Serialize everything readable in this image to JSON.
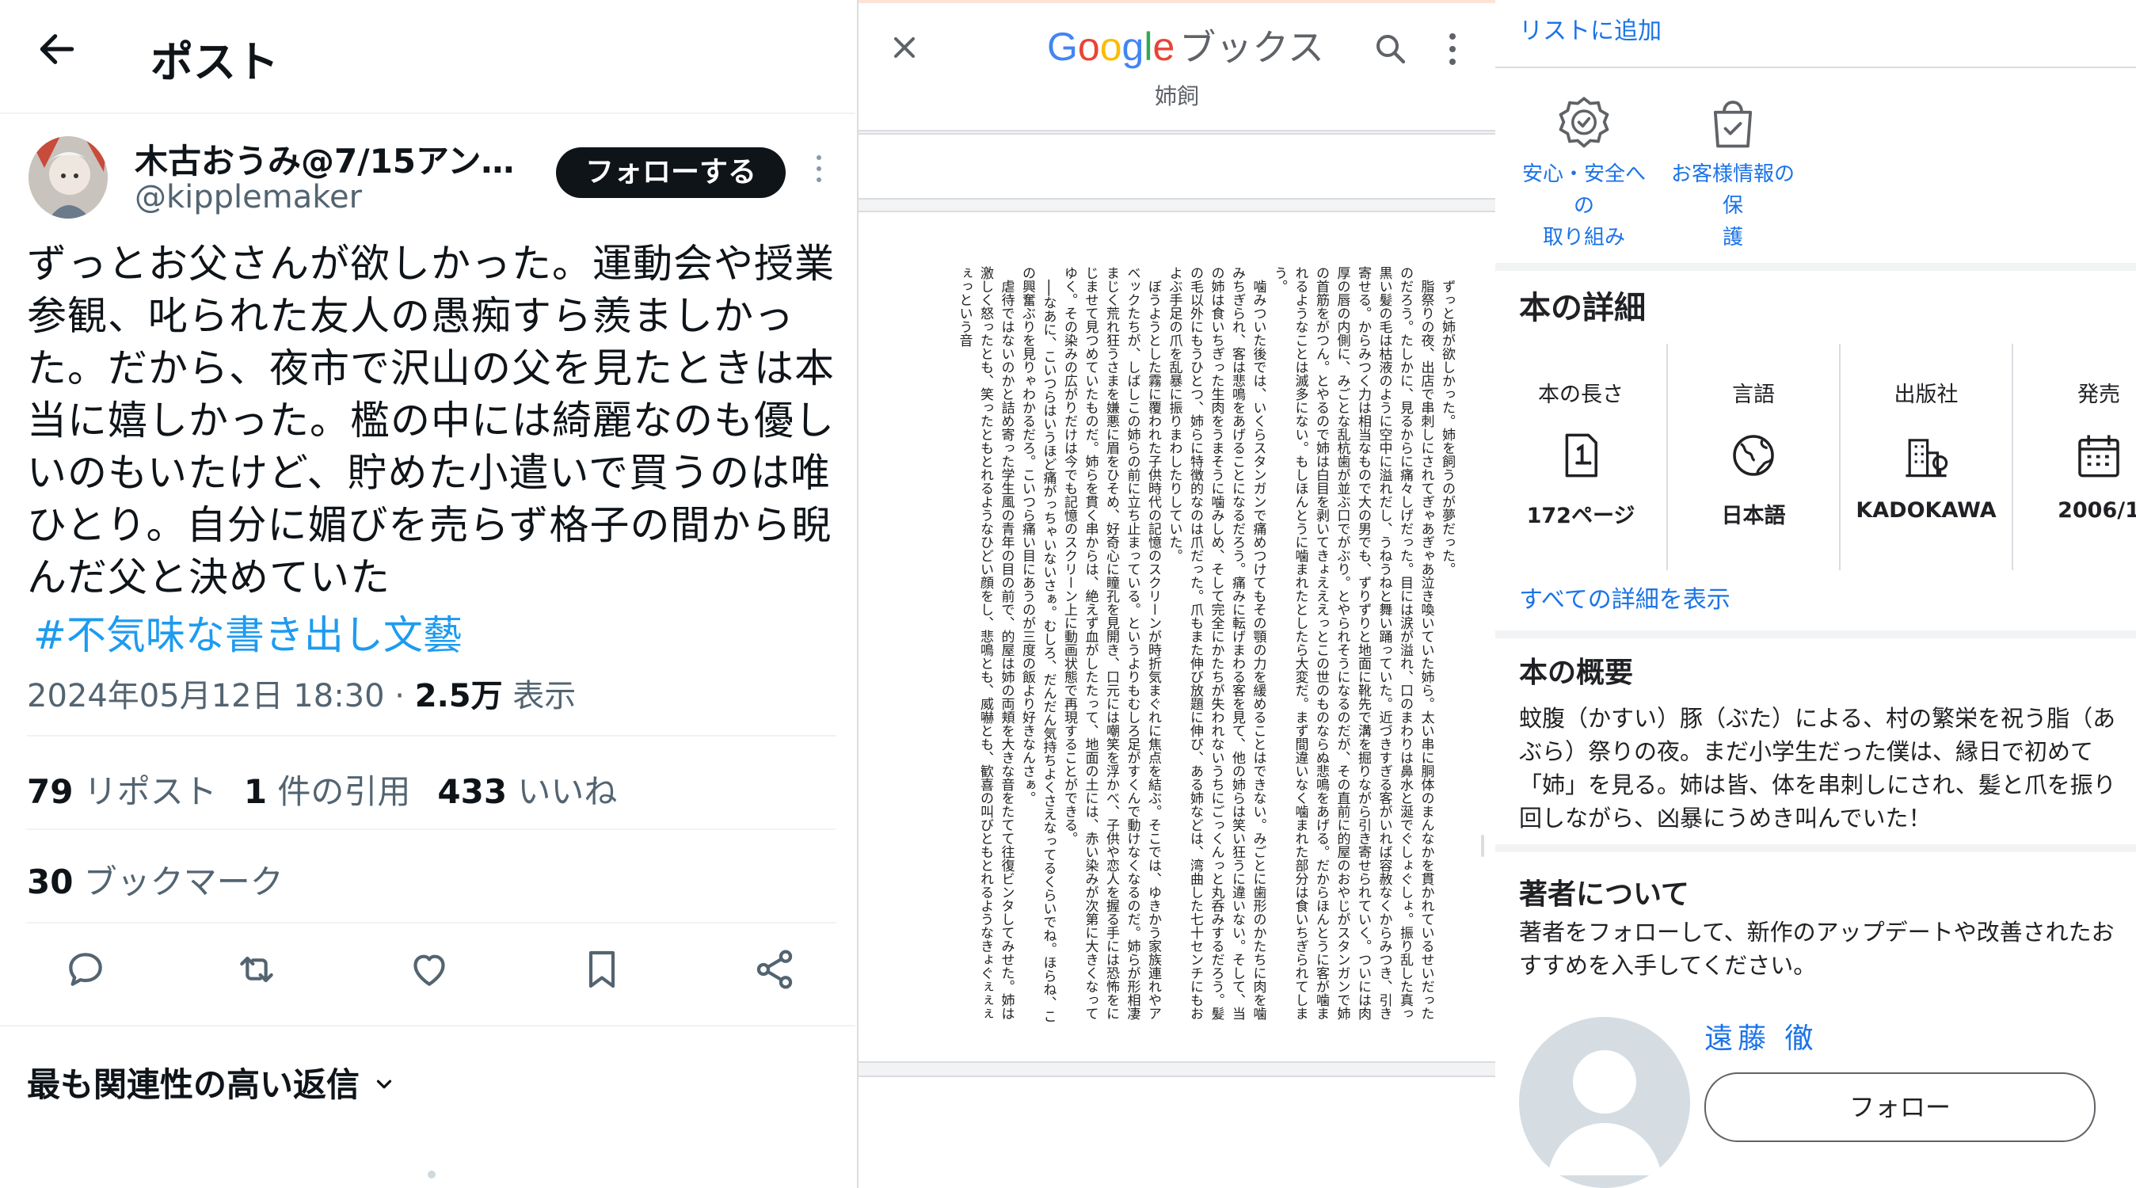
{
  "post_panel": {
    "header_title": "ポスト",
    "author_name": "木古おうみ@7/15アンソ…",
    "author_handle": "@kipplemaker",
    "follow_label": "フォローする",
    "text_lines": [
      "ずっとお父さんが欲しかった。運動会や授業",
      "参観、叱られた友人の愚痴すら羨ましかっ",
      "た。だから、夜市で沢山の父を見たときは本",
      "当に嬉しかった。檻の中には綺麗なのも優し",
      "いのもいたけど、貯めた小遣いで買うのは唯",
      "ひとり。自分に媚びを売らず格子の間から睨",
      "んだ父と決めていた"
    ],
    "hashtag": "#不気味な書き出し文藝",
    "timestamp": "2024年05月12日 18:30 · ",
    "views_count": "2.5万",
    "views_label": " 表示",
    "reposts_count": "79",
    "reposts_label": " リポスト",
    "quotes_count": "1",
    "quotes_label": " 件の引用",
    "likes_count": "433",
    "likes_label": " いいね",
    "bookmarks_count": "30",
    "bookmarks_label": " ブックマーク",
    "reply_sort_label": "最も関連性の高い返信"
  },
  "reader_panel": {
    "logo_product": "ブックス",
    "logo_colors": [
      "#4285f4",
      "#ea4335",
      "#fbbc05",
      "#4285f4",
      "#34a853",
      "#ea4335"
    ],
    "book_title": "姉飼",
    "page_paragraphs": [
      "ずっと姉が欲しかった。姉を飼うのが夢だった。",
      "脂祭りの夜、出店で串刺しにされてぎゃあぎゃあ泣き喚いていた姉ら。太い串に胴体のまんなかを貫かれているせいだったのだろう。たしかに、見るからに痛々しげだった。目には涙が溢れ、口のまわりは鼻水と涎でぐしょぐしょ。振り乱した真っ黒い髪の毛は枯液のように空中に溢れだし、うねうねと舞い踊っていた。近づきすぎる客がいれば容赦なくからみつき、引き寄せる。からみつく力は相当なもので大の男でも、ずりずりと地面に靴先で溝を掘りながら引き寄せられていく。ついには肉厚の唇の内側に、みごとな乱杭歯が並ぶ口でがぶり。とやられそうになるのだが、その直前に的屋のおやじがスタンガンで姉の首筋をがつん。とやるので姉は白目を剥いてきょえええっとこの世のものならぬ悲鳴をあげる。だからほんとうに客が噛まれるようなことは滅多にない。もしほんとうに噛まれたとしたら大変だ。まず間違いなく噛まれた部分は食いちぎられてしまう。",
      "噛みついた後では、いくらスタンガンで痛めつけてもその顎の力を緩めることはできない。みごとに歯形のかたちに肉を噛みちぎられ、客は悲鳴をあげることになるだろう。痛みに転げまわる客を見て、他の姉らは笑い狂うに違いない。そして、当の姉は食いちぎった生肉をうまそうに噛みしめ、そして完全にかたちが失われないうちにごっくんっと丸呑みするだろう。髪の毛以外にもうひとつ、姉らに特徴的なのは爪だった。爪もまた伸び放題に伸び、ある姉などは、湾曲した七十センチにもおよぶ手足の爪を乱暴に振りまわしたりしていた。",
      "ぼうようとした霧に覆われた子供時代の記憶のスクリーンが時折気まぐれに焦点を結ぶ。そこでは、ゆきかう家族連れやアベックたちが、しばしこの姉らの前に立ち止まっている。というよりもむしろ足がすくんで動けなくなるのだ。姉らが形相凄まじく荒れ狂うさまを嫌悪に眉をひそめ、好奇心に瞳孔を見開き、口元には嘲笑を浮かべ、子供や恋人を握る手には恐怖をにじませて見つめていたものだ。姉らを貫く串からは、絶えず血がしたたって、地面の土には、赤い染みが次第に大きくなってゆく。その染みの広がりだけは今でも記憶のスクリーン上に動画状態で再現することができる。",
      "──なあに、こいつらはいうほど痛がっちゃいないさぁ。むしろ、だんだん気持ちよくさえなってるくらいでね。ほらね、この興奮ぶりを見りゃわかるだろ。こいつら痛い目にあうのが三度の飯より好きなんさぁ。",
      "虐待ではないのかと詰め寄った学生風の青年の目の前で、的屋は姉の両頬を大きな音をたてて往復ビンタしてみせた。姉は激しく怒ったとも、笑ったともとれるようなひどい顔をし、悲鳴とも、威嚇とも、歓喜の叫びともとれるようなきょぐぇぇぇぇっという音"
    ]
  },
  "details_panel": {
    "add_to_list": "リストに追加",
    "badges": [
      {
        "line1": "安心・安全への",
        "line2": "取り組み",
        "icon": "verified-badge-icon"
      },
      {
        "line1": "お客様情報の保",
        "line2": "護",
        "icon": "shopping-bag-check-icon"
      }
    ],
    "details_title": "本の詳細",
    "details": [
      {
        "label": "本の長さ",
        "value": "172ページ",
        "icon": "page-count-icon"
      },
      {
        "label": "言語",
        "value": "日本語",
        "icon": "globe-icon"
      },
      {
        "label": "出版社",
        "value": "KADOKAWA",
        "icon": "building-icon"
      },
      {
        "label": "発売",
        "value": "2006/1",
        "icon": "calendar-icon"
      }
    ],
    "all_details_link": "すべての詳細を表示",
    "summary_title": "本の概要",
    "summary_text": "蚊腹（かすい）豚（ぶた）による、村の繁栄を祝う脂（あぶら）祭りの夜。まだ小学生だった僕は、縁日で初めて「姉」を見る。姉は皆、体を串刺しにされ、髪と爪を振り回しながら、凶暴にうめき叫んでいた！",
    "about_title": "著者について",
    "about_text": "著者をフォローして、新作のアップデートや改善されたおすすめを入手してください。",
    "author_name": "遠藤 徹",
    "follow_label": "フォロー"
  }
}
